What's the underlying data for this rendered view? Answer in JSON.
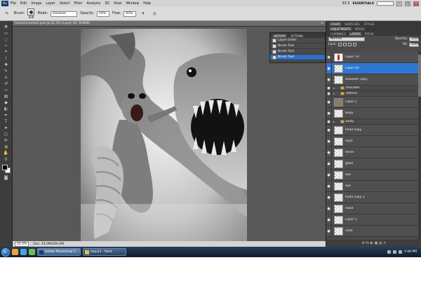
{
  "menubar": {
    "items": [
      "File",
      "Edit",
      "Image",
      "Layer",
      "Select",
      "Filter",
      "Analysis",
      "3D",
      "View",
      "Window",
      "Help"
    ],
    "zoom_menu": "33.3",
    "workspace": "ESSENTIALS",
    "win_min": "–",
    "win_max": "□",
    "win_close": "x"
  },
  "options": {
    "brush_label": "Brush:",
    "brush_size": "608",
    "mode_label": "Mode:",
    "mode_value": "Dissolve",
    "opacity_label": "Opacity:",
    "opacity_value": "14%",
    "flow_label": "Flow:",
    "flow_value": "93%"
  },
  "document": {
    "tab_title": "humaninvasion.psd @ 22.3% (Layer 45, RGB/8)",
    "close": "×",
    "status_zoom": "22.3%",
    "status_doc": "Doc: 24.0M/200.0M"
  },
  "history": {
    "tabs": [
      "HISTORY",
      "ACTIONS"
    ],
    "rows": [
      {
        "label": "Layer Order",
        "active": false
      },
      {
        "label": "Brush Tool",
        "active": false
      },
      {
        "label": "Brush Tool",
        "active": false
      },
      {
        "label": "Brush Tool",
        "active": true
      }
    ]
  },
  "panels": {
    "top_tabs": [
      "COLOR",
      "SWATCHES",
      "STYLES"
    ],
    "mid_tabs": [
      "ADJUSTMENTS",
      "MASKS"
    ],
    "layer_tabs": [
      "CHANNELS",
      "LAYERS",
      "PATHS"
    ],
    "blend_mode": "Normal",
    "opacity_label": "Opacity:",
    "opacity_value": "100%",
    "lock_label": "Lock:",
    "fill_label": "Fill:",
    "fill_value": "100%"
  },
  "layers": [
    {
      "name": "Layer 10",
      "kind": "layer",
      "thumb": "red",
      "active": false
    },
    {
      "name": "Layer 45",
      "kind": "layer",
      "thumb": "checker",
      "active": true
    },
    {
      "name": "shoulder copy",
      "kind": "layer",
      "thumb": "checker",
      "active": false
    },
    {
      "name": "shoulder",
      "kind": "group",
      "active": false
    },
    {
      "name": "tattons",
      "kind": "group",
      "active": false
    },
    {
      "name": "Layer 1",
      "kind": "layer",
      "thumb": "dark",
      "active": false
    },
    {
      "name": "body",
      "kind": "layer",
      "thumb": "checker",
      "active": false
    },
    {
      "name": "body",
      "kind": "group",
      "active": false
    },
    {
      "name": "head copy",
      "kind": "layer",
      "thumb": "checker",
      "active": false
    },
    {
      "name": "nose",
      "kind": "layer",
      "thumb": "checker",
      "active": false
    },
    {
      "name": "shine",
      "kind": "layer",
      "thumb": "checker",
      "active": false
    },
    {
      "name": "glare",
      "kind": "layer",
      "thumb": "checker",
      "active": false
    },
    {
      "name": "eye",
      "kind": "layer",
      "thumb": "checker",
      "active": false
    },
    {
      "name": "eye",
      "kind": "layer",
      "thumb": "checker",
      "active": false
    },
    {
      "name": "head copy 2",
      "kind": "layer",
      "thumb": "checker",
      "active": false
    },
    {
      "name": "head",
      "kind": "layer",
      "thumb": "checker",
      "active": false
    },
    {
      "name": "Layer 5",
      "kind": "layer",
      "thumb": "checker",
      "active": false
    },
    {
      "name": "neck",
      "kind": "layer",
      "thumb": "checker",
      "active": false
    }
  ],
  "layers_footer": "⊕ fx ◐ ▣ ▤ ✕",
  "taskbar": {
    "items": [
      {
        "label": "Adobe Photoshop C...",
        "active": true
      },
      {
        "label": "daju21 - Paint",
        "active": false
      }
    ],
    "time": "1:06 PM"
  },
  "colors": {
    "accent": "#2f76d2",
    "panel_bg": "#4a4a4a",
    "canvas_bg": "#585858"
  }
}
